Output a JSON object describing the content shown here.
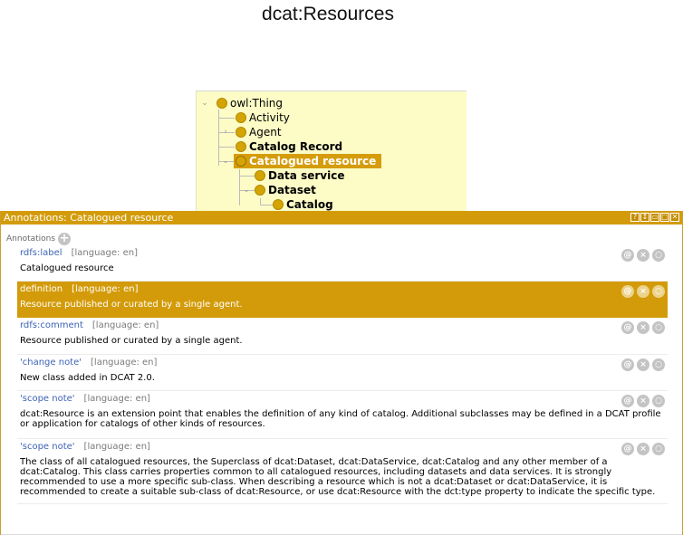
{
  "page": {
    "title": "dcat:Resources"
  },
  "tree": {
    "items": [
      {
        "label": "owl:Thing"
      },
      {
        "label": "Activity"
      },
      {
        "label": "Agent"
      },
      {
        "label": "Catalog Record"
      },
      {
        "label": "Catalogued resource"
      },
      {
        "label": "Data service"
      },
      {
        "label": "Dataset"
      },
      {
        "label": "Catalog"
      }
    ],
    "selected": "Catalogued resource",
    "selection_color": "#d59d0c"
  },
  "annotations_panel": {
    "title": "Annotations: Catalogued resource",
    "header_color": "#d39b09",
    "section_label": "Annotations",
    "add_icon": "plus-icon",
    "header_buttons": [
      "?",
      "↕",
      "▭",
      "□",
      "✕"
    ],
    "row_buttons": [
      "@",
      "×",
      "○"
    ],
    "items": [
      {
        "property": "rdfs:label",
        "language": "[language: en]",
        "value": "Catalogued resource"
      },
      {
        "property": "definition",
        "language": "[language: en]",
        "value": "Resource published or curated by a single agent."
      },
      {
        "property": "rdfs:comment",
        "language": "[language: en]",
        "value": "Resource published or curated by a single agent."
      },
      {
        "property": "'change note'",
        "language": "[language: en]",
        "value": "New class added in DCAT 2.0."
      },
      {
        "property": "'scope note'",
        "language": "[language: en]",
        "value": "dcat:Resource is an extension point that enables the definition of any kind of catalog. Additional subclasses may be defined in a DCAT profile or application for catalogs of other kinds of resources."
      },
      {
        "property": "'scope note'",
        "language": "[language: en]",
        "value": "The class of all catalogued resources, the Superclass of dcat:Dataset, dcat:DataService, dcat:Catalog and any other member of a dcat:Catalog. This class carries properties common to all catalogued resources, including datasets and data services. It is strongly recommended to use a more specific sub-class. When describing a resource which is not a dcat:Dataset or dcat:DataService, it is recommended to create a suitable sub-class of dcat:Resource, or use dcat:Resource with the dct:type property to indicate the specific type."
      }
    ]
  }
}
